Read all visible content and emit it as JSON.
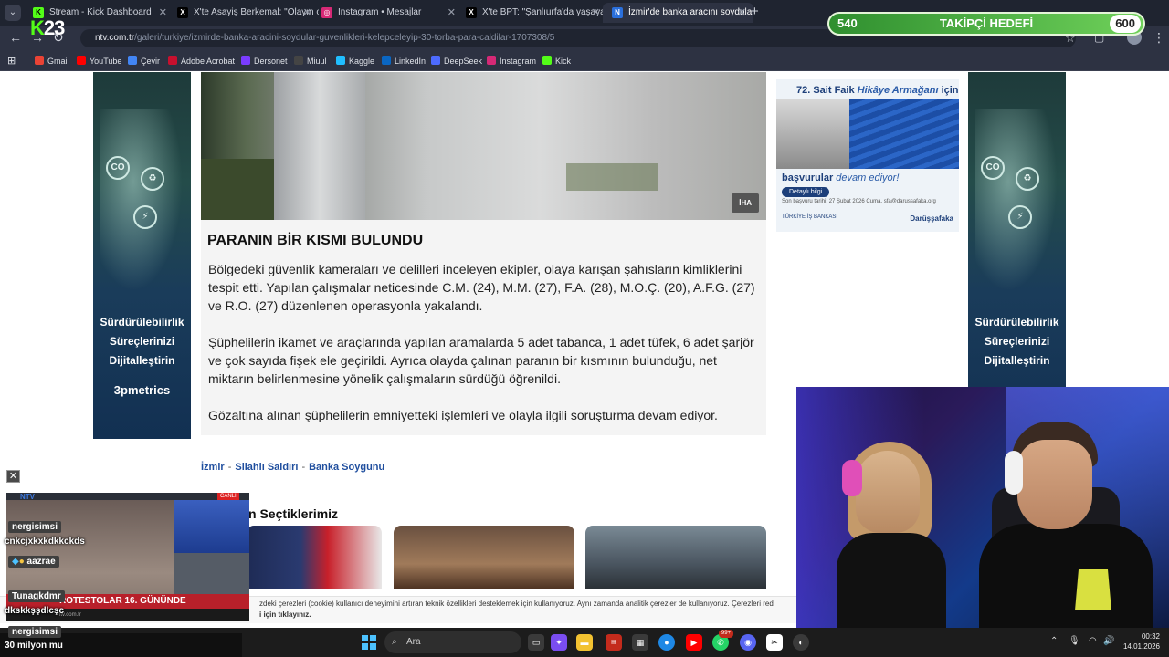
{
  "browser": {
    "tabs": [
      {
        "title": "Stream - Kick Dashboard",
        "icon": "kick-icon",
        "color": "#53fc18"
      },
      {
        "title": "X'te Asayiş Berkemal: \"Olayın o",
        "icon": "x-icon",
        "color": "#000000"
      },
      {
        "title": "Instagram • Mesajlar",
        "icon": "instagram-icon",
        "color": "#d62976"
      },
      {
        "title": "X'te BPT: \"Şanlıurfa'da yaşayan",
        "icon": "x-icon",
        "color": "#000000"
      },
      {
        "title": "İzmir'de banka aracını soydular",
        "icon": "ntv-icon",
        "color": "#2a6fdb"
      }
    ],
    "url_host": "ntv.com.tr",
    "url_path": "/galeri/turkiye/izmirde-banka-aracini-soydular-guvenlikleri-kelepceleyip-30-torba-para-caldilar-1707308/5",
    "bookmarks": [
      {
        "label": "Gmail",
        "color": "#ea4335"
      },
      {
        "label": "YouTube",
        "color": "#ff0000"
      },
      {
        "label": "Çevir",
        "color": "#4285f4"
      },
      {
        "label": "Adobe Acrobat",
        "color": "#c8102e"
      },
      {
        "label": "Dersonet",
        "color": "#7a3cff"
      },
      {
        "label": "Miuul",
        "color": "#444444"
      },
      {
        "label": "Kaggle",
        "color": "#20beff"
      },
      {
        "label": "LinkedIn",
        "color": "#0a66c2"
      },
      {
        "label": "DeepSeek",
        "color": "#4d6bfe"
      },
      {
        "label": "Instagram",
        "color": "#d62976"
      },
      {
        "label": "Kick",
        "color": "#53fc18"
      }
    ]
  },
  "overlay": {
    "kick_logo": "23",
    "goal_left": "540",
    "goal_title": "TAKİPÇİ HEDEFİ",
    "goal_right": "600"
  },
  "ads": {
    "side_text_1": "Sürdürülebilirlik",
    "side_text_2": "Süreçlerinizi",
    "side_text_3": "Dijitalleştirin",
    "side_brand": "3pmetrics",
    "right_title_a": "72. Sait Faik ",
    "right_title_b": "Hikâye Armağanı",
    "right_title_c": " için",
    "right_line": "başvurular",
    "right_line_b": " devam ediyor!",
    "right_button": "Detaylı bilgi",
    "right_small": "Son başvuru tarihi: 27 Şubat 2026 Cuma, sfa@darussafaka.org",
    "right_org": "Darüşşafaka",
    "right_bank": "TÜRKİYE İŞ BANKASI"
  },
  "article": {
    "photo_tag": "İHA",
    "heading": "PARANIN BİR KISMI BULUNDU",
    "paragraphs": [
      "Bölgedeki güvenlik kameraları ve delilleri inceleyen ekipler, olaya karışan şahısların kimliklerini tespit etti. Yapılan çalışmalar neticesinde C.M. (24), M.M. (27), F.A. (28), M.O.Ç. (20), A.F.G. (27) ve R.O. (27) düzenlenen operasyonla yakalandı.",
      "Şüphelilerin ikamet ve araçlarında yapılan aramalarda 5 adet tabanca, 1 adet tüfek, 6 adet şarjör ve çok sayıda fişek ele geçirildi. Ayrıca olayda çalınan paranın bir kısmının bulunduğu, net miktarın belirlenmesine yönelik çalışmaların sürdüğü öğrenildi.",
      "Gözaltına alınan şüphelilerin emniyetteki işlemleri ve olayla ilgili soruşturma devam ediyor."
    ],
    "tags": [
      "İzmir",
      "Silahlı Saldırı",
      "Banka Soygunu"
    ],
    "picks_title": "n Seçtiklerimiz",
    "cookie_text": "zdeki çerezleri (cookie) kullanıcı deneyimini artıran teknik özellikleri desteklemek için kullanıyoruz. Aynı zamanda analitik çerezler de kullanıyoruz. Çerezleri red",
    "cookie_link": "i için tıklayınız."
  },
  "tv": {
    "logo": "NTV",
    "live": "CANLI",
    "lower_third": "ROTESTOLAR 16. GÜNÜNDE",
    "ticker": "ntv.com.tr"
  },
  "chat": [
    {
      "user": "nergisimsi",
      "message": "cnkcjxkxkdkkckds"
    },
    {
      "user": "aazrae",
      "message": ""
    },
    {
      "user": "Tunagkdmr",
      "message": "dkskkşşdlcşc"
    },
    {
      "user": "nergisimsi",
      "message": "30 milyon mu"
    }
  ],
  "taskbar": {
    "search_label": "Ara",
    "time": "00:32",
    "date": "14.01.2026",
    "badge": "99+"
  }
}
